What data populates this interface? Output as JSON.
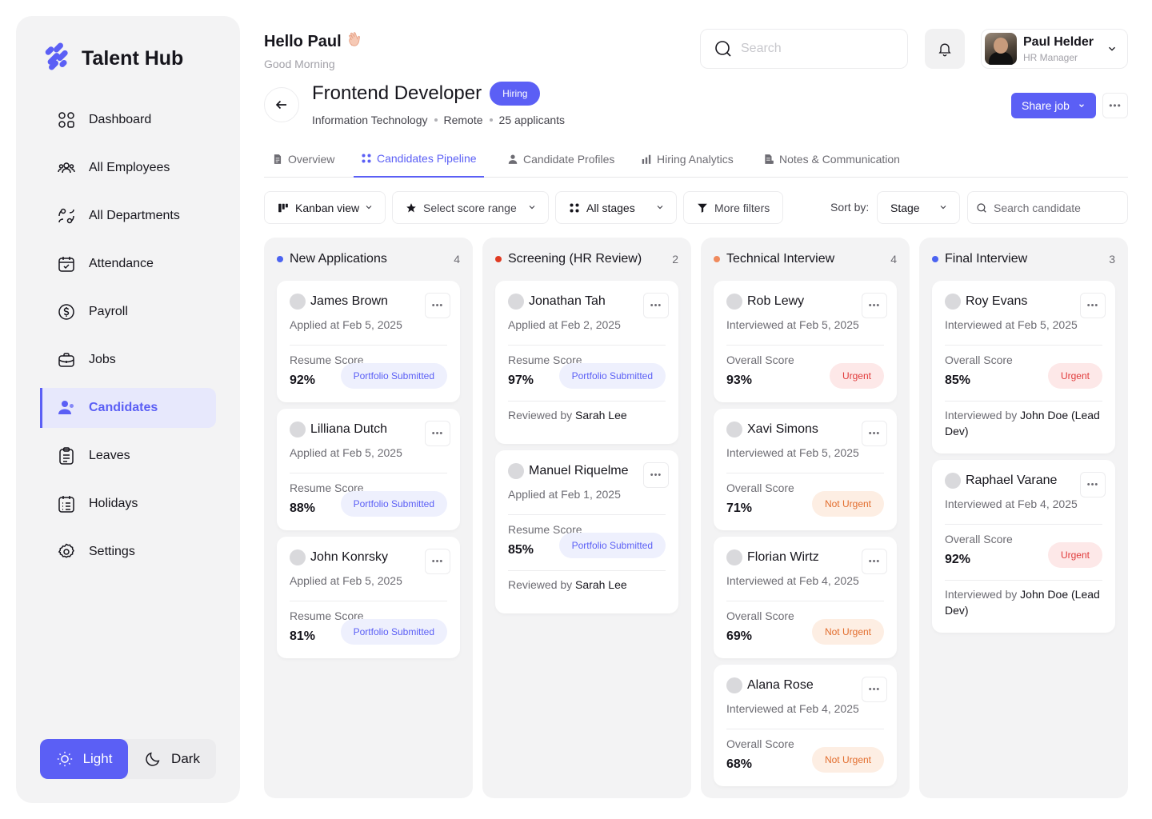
{
  "brand": {
    "name": "Talent Hub"
  },
  "nav": [
    {
      "label": "Dashboard",
      "icon": "dashboard-icon"
    },
    {
      "label": "All Employees",
      "icon": "users-icon"
    },
    {
      "label": "All Departments",
      "icon": "departments-icon"
    },
    {
      "label": "Attendance",
      "icon": "calendar-check-icon"
    },
    {
      "label": "Payroll",
      "icon": "dollar-icon"
    },
    {
      "label": "Jobs",
      "icon": "briefcase-icon"
    },
    {
      "label": "Candidates",
      "icon": "candidates-icon",
      "active": true
    },
    {
      "label": "Leaves",
      "icon": "clipboard-icon"
    },
    {
      "label": "Holidays",
      "icon": "list-icon"
    },
    {
      "label": "Settings",
      "icon": "gear-icon"
    }
  ],
  "theme": {
    "light": "Light",
    "dark": "Dark"
  },
  "header": {
    "hello": "Hello Paul",
    "greeting": "Good Morning",
    "search_placeholder": "Search",
    "user_name": "Paul Helder",
    "user_role": "HR Manager"
  },
  "job": {
    "title": "Frontend Developer",
    "status": "Hiring",
    "department": "Information Technology",
    "location": "Remote",
    "applicants": "25 applicants",
    "share_label": "Share job"
  },
  "tabs": [
    "Overview",
    "Candidates Pipeline",
    "Candidate Profiles",
    "Hiring Analytics",
    "Notes & Communication"
  ],
  "filters": {
    "view": "Kanban view",
    "score": "Select score range",
    "stages": "All stages",
    "more": "More filters",
    "sort_label": "Sort by:",
    "sort_value": "Stage",
    "search_placeholder": "Search candidate"
  },
  "columns": [
    {
      "title": "New Applications",
      "count": "4",
      "color": "#4b63f1",
      "cards": [
        {
          "name": "James Brown",
          "date": "Applied at Feb 5, 2025",
          "score_label": "Resume Score",
          "score": "92%",
          "pill": "Portfolio Submitted",
          "pill_type": "port"
        },
        {
          "name": "Lilliana Dutch",
          "date": "Applied at Feb 5, 2025",
          "score_label": "Resume Score",
          "score": "88%",
          "pill": "Portfolio Submitted",
          "pill_type": "port"
        },
        {
          "name": "John Konrsky",
          "date": "Applied at Feb 5, 2025",
          "score_label": "Resume Score",
          "score": "81%",
          "pill": "Portfolio Submitted",
          "pill_type": "port"
        }
      ]
    },
    {
      "title": "Screening (HR Review)",
      "count": "2",
      "color": "#e03b23",
      "cards": [
        {
          "name": "Jonathan Tah",
          "date": "Applied at Feb 2, 2025",
          "score_label": "Resume Score",
          "score": "97%",
          "pill": "Portfolio Submitted",
          "pill_type": "port",
          "foot_prefix": "Reviewed by",
          "foot_name": "Sarah Lee"
        },
        {
          "name": "Manuel Riquelme",
          "date": "Applied at Feb 1, 2025",
          "score_label": "Resume Score",
          "score": "85%",
          "pill": "Portfolio Submitted",
          "pill_type": "port",
          "foot_prefix": "Reviewed by",
          "foot_name": "Sarah Lee"
        }
      ]
    },
    {
      "title": "Technical Interview",
      "count": "4",
      "color": "#f08a5d",
      "cards": [
        {
          "name": "Rob Lewy",
          "date": "Interviewed at Feb 5, 2025",
          "score_label": "Overall Score",
          "score": "93%",
          "pill": "Urgent",
          "pill_type": "urgent"
        },
        {
          "name": "Xavi Simons",
          "date": "Interviewed at Feb 5, 2025",
          "score_label": "Overall Score",
          "score": "71%",
          "pill": "Not Urgent",
          "pill_type": "noturgent"
        },
        {
          "name": "Florian Wirtz",
          "date": "Interviewed at Feb 4, 2025",
          "score_label": "Overall Score",
          "score": "69%",
          "pill": "Not Urgent",
          "pill_type": "noturgent"
        },
        {
          "name": "Alana Rose",
          "date": "Interviewed at Feb 4, 2025",
          "score_label": "Overall Score",
          "score": "68%",
          "pill": "Not Urgent",
          "pill_type": "noturgent"
        }
      ]
    },
    {
      "title": "Final Interview",
      "count": "3",
      "color": "#4b63f1",
      "cards": [
        {
          "name": "Roy Evans",
          "date": "Interviewed at Feb 5, 2025",
          "score_label": "Overall Score",
          "score": "85%",
          "pill": "Urgent",
          "pill_type": "urgent",
          "foot_prefix": "Interviewed by",
          "foot_name": "John Doe (Lead Dev)"
        },
        {
          "name": "Raphael Varane",
          "date": "Interviewed at Feb 4, 2025",
          "score_label": "Overall Score",
          "score": "92%",
          "pill": "Urgent",
          "pill_type": "urgent",
          "foot_prefix": "Interviewed by",
          "foot_name": "John Doe (Lead Dev)"
        }
      ]
    }
  ],
  "colors": {
    "accent": "#5b5ff5",
    "urgent": "#e03b3b",
    "not_urgent": "#e26d2d"
  }
}
